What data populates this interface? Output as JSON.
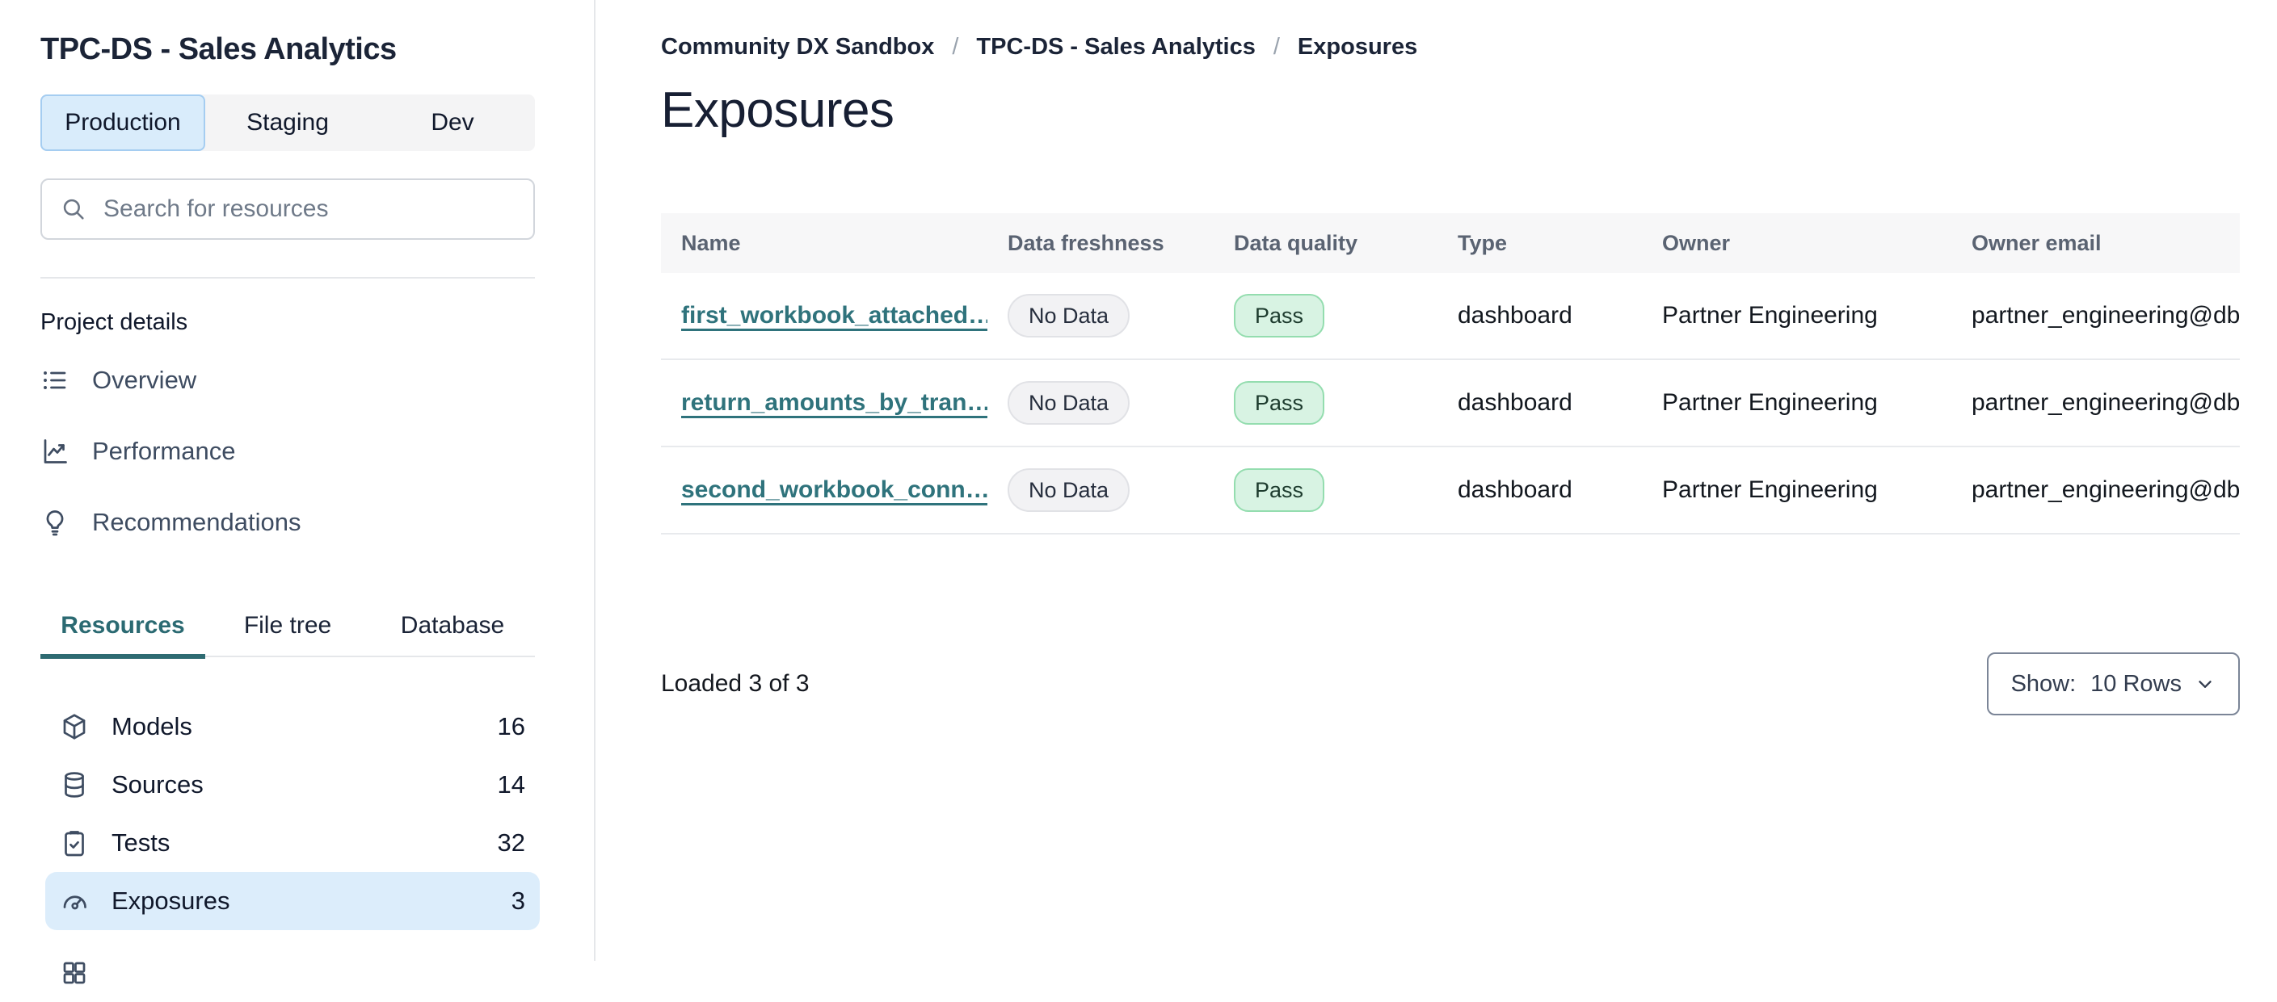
{
  "sidebar": {
    "project_title": "TPC-DS - Sales Analytics",
    "env_tabs": [
      {
        "label": "Production",
        "active": true
      },
      {
        "label": "Staging",
        "active": false
      },
      {
        "label": "Dev",
        "active": false
      }
    ],
    "search_placeholder": "Search for resources",
    "section_label": "Project details",
    "nav_items": [
      {
        "label": "Overview",
        "icon": "list-icon"
      },
      {
        "label": "Performance",
        "icon": "chart-line-icon"
      },
      {
        "label": "Recommendations",
        "icon": "lightbulb-icon"
      }
    ],
    "resource_tabs": [
      {
        "label": "Resources",
        "active": true
      },
      {
        "label": "File tree",
        "active": false
      },
      {
        "label": "Database",
        "active": false
      }
    ],
    "resources": [
      {
        "label": "Models",
        "count": "16",
        "icon": "package-icon",
        "selected": false
      },
      {
        "label": "Sources",
        "count": "14",
        "icon": "database-icon",
        "selected": false
      },
      {
        "label": "Tests",
        "count": "32",
        "icon": "clipboard-check-icon",
        "selected": false
      },
      {
        "label": "Exposures",
        "count": "3",
        "icon": "gauge-icon",
        "selected": true
      }
    ]
  },
  "main": {
    "breadcrumb": [
      "Community DX Sandbox",
      "TPC-DS - Sales Analytics",
      "Exposures"
    ],
    "separator": "/",
    "page_title": "Exposures",
    "table": {
      "columns": [
        "Name",
        "Data freshness",
        "Data quality",
        "Type",
        "Owner",
        "Owner email"
      ],
      "rows": [
        {
          "name": "first_workbook_attached…",
          "freshness": "No Data",
          "quality": "Pass",
          "type": "dashboard",
          "owner": "Partner Engineering",
          "owner_email": "partner_engineering@dbt…"
        },
        {
          "name": "return_amounts_by_tran…",
          "freshness": "No Data",
          "quality": "Pass",
          "type": "dashboard",
          "owner": "Partner Engineering",
          "owner_email": "partner_engineering@dbt…"
        },
        {
          "name": "second_workbook_conn…",
          "freshness": "No Data",
          "quality": "Pass",
          "type": "dashboard",
          "owner": "Partner Engineering",
          "owner_email": "partner_engineering@dbt…"
        }
      ]
    },
    "footer": {
      "loaded_text": "Loaded 3 of 3",
      "show_label": "Show:",
      "show_value": "10 Rows"
    }
  },
  "colors": {
    "link_teal": "#2f737c",
    "tab_teal": "#2e6b72",
    "selection_blue": "#dcedfb",
    "env_active_bg": "#d9ecfb",
    "env_active_border": "#a5cdf1",
    "pass_bg": "#d8f3e3",
    "pass_border": "#94ddaf",
    "neutral_badge_bg": "#f2f2f4",
    "neutral_badge_border": "#e1e2e6",
    "table_header_bg": "#f7f7f8",
    "divider_gray": "#e5e7ea",
    "text_primary": "#1b2437",
    "text_secondary": "#5a6372"
  }
}
